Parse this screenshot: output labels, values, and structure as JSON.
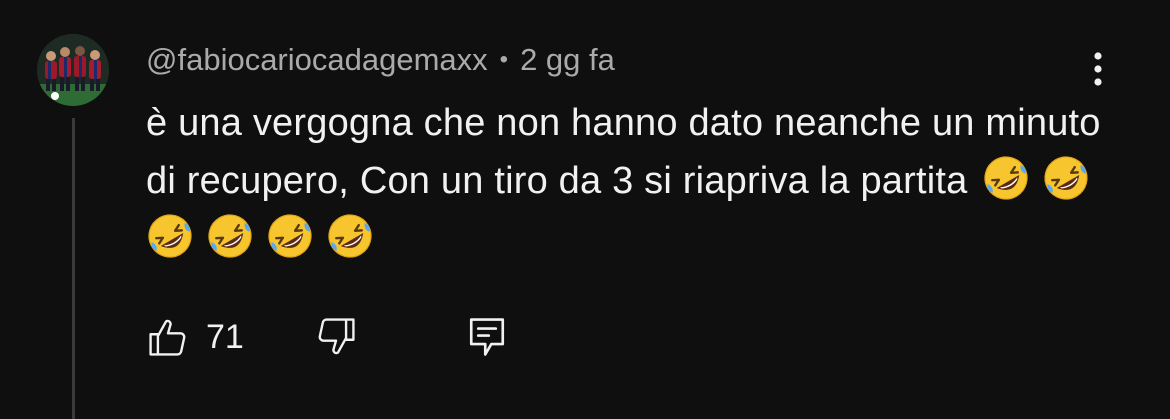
{
  "comment": {
    "author": "@fabiocariocadagemaxx",
    "separator": "•",
    "timestamp": "2 gg fa",
    "text": "è una vergogna che non hanno dato neanche un minuto di recupero, Con un tiro da 3 si riapriva la partita",
    "emoji": [
      "rolling-on-floor-laughing",
      "rolling-on-floor-laughing",
      "rolling-on-floor-laughing",
      "rolling-on-floor-laughing",
      "rolling-on-floor-laughing",
      "rolling-on-floor-laughing"
    ]
  },
  "actions": {
    "like_count": "71",
    "like_icon": "thumbs-up-icon",
    "dislike_icon": "thumbs-down-icon",
    "reply_icon": "reply-icon",
    "menu_icon": "more-vert-icon"
  },
  "colors": {
    "background": "#0f0f0f",
    "text": "#f1f1f1",
    "secondary": "#aaaaaa",
    "thread_line": "#3a3a3a"
  }
}
